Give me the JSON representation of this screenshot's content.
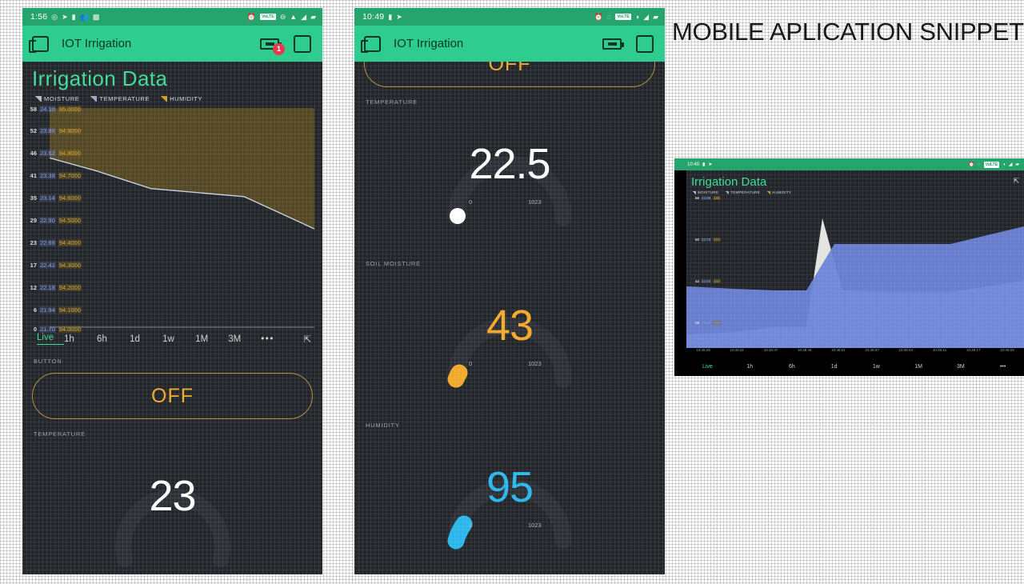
{
  "heading": "MOBILE APLICATION SNIPPETS",
  "app": {
    "title": "IOT Irrigation",
    "widget_title": "Irrigation Data",
    "accent_green": "#2ecc8f",
    "status_green": "#26a46d",
    "title_green": "#3ddc97",
    "orange": "#f0a92a",
    "blue": "#29b6ea",
    "screen_bg": "#22262b"
  },
  "phone1": {
    "status": {
      "time": "1:56",
      "left_icons": [
        "whatsapp-icon",
        "telegram-icon",
        "battery-saver-icon",
        "contacts-icon",
        "apps-icon"
      ],
      "right_icons": [
        "alarm-icon",
        "volte-icon",
        "dnd-icon",
        "wifi-icon",
        "signal-icon",
        "battery-icon"
      ],
      "volte_label": "VoLTE"
    },
    "appbar": {
      "nav_icon": "login-icon",
      "title": "IOT Irrigation",
      "battery_icon": "battery-icon",
      "badge_count": "1",
      "square_icon": "square-icon"
    },
    "legend": [
      {
        "label": "MOISTURE",
        "color": "#b8b8c8"
      },
      {
        "label": "TEMPERATURE",
        "color": "#9aa7c4"
      },
      {
        "label": "HUMIDITY",
        "color": "#c99b28"
      }
    ],
    "ranges": [
      "Live",
      "1h",
      "6h",
      "1d",
      "1w",
      "1M",
      "3M"
    ],
    "ranges_more": "•••",
    "range_active": "Live",
    "expand_icon": "expand-icon",
    "button_label": "BUTTON",
    "button_state": "OFF",
    "temperature_label": "TEMPERATURE",
    "temperature_value": "23"
  },
  "phone2": {
    "status": {
      "time": "10:49",
      "left_icons": [
        "battery-saver-icon",
        "telegram-icon"
      ],
      "right_icons": [
        "alarm-icon",
        "dnd-icon",
        "volte-icon",
        "circle-icon",
        "signal-icon",
        "battery-icon"
      ],
      "volte_label": "VoLTE"
    },
    "appbar": {
      "nav_icon": "login-icon",
      "title": "IOT Irrigation",
      "battery_icon": "battery-icon",
      "square_icon": "square-icon"
    },
    "button_state": "OFF",
    "gauges": [
      {
        "label": "TEMPERATURE",
        "value": "22.5",
        "min": "0",
        "max": "1023",
        "color": "#ffffff",
        "fraction": 0.022
      },
      {
        "label": "SOIL MOISTURE",
        "value": "43",
        "min": "0",
        "max": "1023",
        "color": "#f0a92a",
        "fraction": 0.042
      },
      {
        "label": "HUMIDITY",
        "value": "95",
        "min": "0",
        "max": "1023",
        "color": "#29b6ea",
        "fraction": 0.093
      }
    ]
  },
  "landscape": {
    "status_time": "10:49",
    "title": "Irrigation Data",
    "legend": [
      {
        "label": "MOISTURE",
        "color": "#b8b8c8"
      },
      {
        "label": "TEMPERATURE",
        "color": "#9aa7c4"
      },
      {
        "label": "HUMIDITY",
        "color": "#c99b28"
      }
    ],
    "expand_icon": "expand-icon",
    "axis_rows": [
      {
        "m": "56",
        "t": "23.98",
        "h": "105"
      },
      {
        "m": "50",
        "t": "23.75",
        "h": "104"
      },
      {
        "m": "44",
        "t": "23.50",
        "h": "103"
      },
      {
        "m": "38",
        "t": "23.28",
        "h": "102"
      }
    ],
    "x_labels": [
      "10:45:26",
      "10:45:31",
      "10:45:37",
      "10:45:44",
      "10:45:51",
      "10:45:57",
      "10:46:04",
      "10:46:11",
      "10:46:17",
      "10:46:23"
    ],
    "ranges": [
      "Live",
      "1h",
      "6h",
      "1d",
      "1w",
      "1M",
      "3M",
      "•••"
    ],
    "range_active": "Live"
  },
  "chart_data": {
    "type": "area",
    "title": "Irrigation Data",
    "series": [
      {
        "name": "MOISTURE",
        "color": "#b8b8c8",
        "axis_ticks": [
          "58",
          "52",
          "46",
          "41",
          "35",
          "29",
          "23",
          "17",
          "12",
          "6",
          "0"
        ],
        "values": [
          44,
          42,
          41,
          41,
          41,
          41,
          41,
          39,
          36,
          34
        ]
      },
      {
        "name": "TEMPERATURE",
        "color": "#9aa7c4",
        "axis_ticks": [
          "24.10",
          "23.86",
          "23.62",
          "23.38",
          "23.14",
          "22.90",
          "22.66",
          "22.42",
          "22.18",
          "21.94",
          "21.70"
        ],
        "values": [
          23.4,
          23.39,
          23.38,
          23.38,
          23.38,
          23.38,
          23.38,
          23.3,
          23.2,
          23.1
        ]
      },
      {
        "name": "HUMIDITY",
        "color": "#c99b28",
        "axis_ticks": [
          "95.0000",
          "94.9000",
          "94.8000",
          "94.7000",
          "94.6000",
          "94.5000",
          "94.4000",
          "94.3000",
          "94.2000",
          "94.1000",
          "94.0000"
        ],
        "values": [
          95.0,
          95.0,
          95.0,
          95.0,
          95.0,
          95.0,
          95.0,
          95.0,
          95.0,
          95.0
        ]
      }
    ],
    "grid": true,
    "legend_position": "top",
    "ylabel": "",
    "xlabel": ""
  },
  "chart_data_landscape": {
    "type": "area",
    "title": "Irrigation Data",
    "series": [
      {
        "name": "MOISTURE",
        "color": "#e0e0e0",
        "values": [
          0,
          0,
          0,
          0,
          0,
          100,
          0,
          0,
          0,
          0
        ]
      },
      {
        "name": "HUMIDITY",
        "color": "#6b82d6",
        "values": [
          44,
          44,
          43,
          43,
          62,
          62,
          62,
          62,
          62,
          70
        ]
      }
    ],
    "x_labels": [
      "10:45:26",
      "10:45:31",
      "10:45:37",
      "10:45:44",
      "10:45:51",
      "10:45:57",
      "10:46:04",
      "10:46:11",
      "10:46:17",
      "10:46:23"
    ],
    "grid": true,
    "legend_position": "top"
  }
}
